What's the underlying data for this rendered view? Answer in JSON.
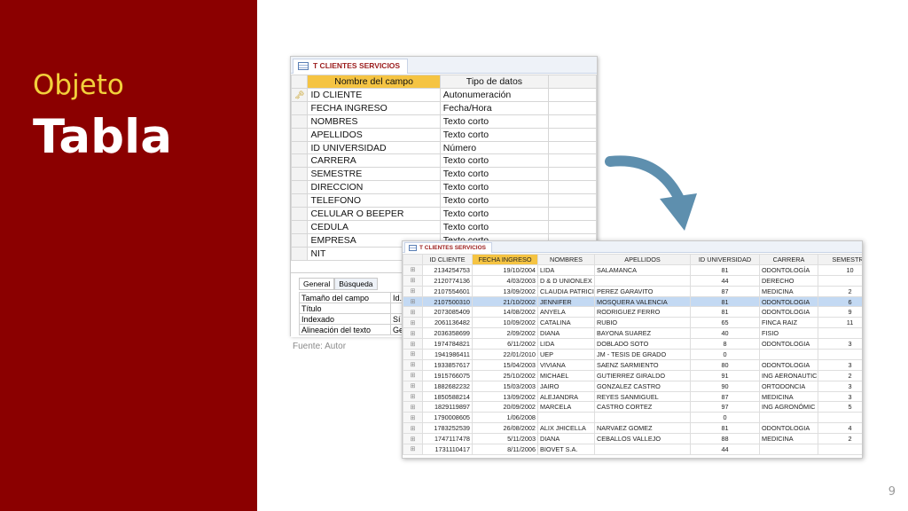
{
  "slide": {
    "subtitle": "Objeto",
    "title": "Tabla",
    "page_number": "9",
    "caption": "Fuente: Autor",
    "colors": {
      "panel": "#8b0000",
      "subtitle": "#f2d03b",
      "title": "#ffffff"
    }
  },
  "design_view": {
    "tab_label": "T CLIENTES SERVICIOS",
    "headers": {
      "name": "Nombre del campo",
      "type": "Tipo de datos"
    },
    "fields": [
      {
        "name": "ID CLIENTE",
        "type": "Autonumeración",
        "key": true
      },
      {
        "name": "FECHA INGRESO",
        "type": "Fecha/Hora",
        "key": false
      },
      {
        "name": "NOMBRES",
        "type": "Texto corto",
        "key": false
      },
      {
        "name": "APELLIDOS",
        "type": "Texto corto",
        "key": false
      },
      {
        "name": "ID UNIVERSIDAD",
        "type": "Número",
        "key": false
      },
      {
        "name": "CARRERA",
        "type": "Texto corto",
        "key": false
      },
      {
        "name": "SEMESTRE",
        "type": "Texto corto",
        "key": false
      },
      {
        "name": "DIRECCION",
        "type": "Texto corto",
        "key": false
      },
      {
        "name": "TELEFONO",
        "type": "Texto corto",
        "key": false
      },
      {
        "name": "CELULAR O BEEPER",
        "type": "Texto corto",
        "key": false
      },
      {
        "name": "CEDULA",
        "type": "Texto corto",
        "key": false
      },
      {
        "name": "EMPRESA",
        "type": "Texto corto",
        "key": false
      },
      {
        "name": "NIT",
        "type": "Texto corto",
        "key": false
      }
    ],
    "property_tabs": [
      "General",
      "Búsqueda"
    ],
    "properties": [
      {
        "label": "Tamaño del campo",
        "value": "Id."
      },
      {
        "label": "Título",
        "value": ""
      },
      {
        "label": "Indexado",
        "value": "Sí ("
      },
      {
        "label": "Alineación del texto",
        "value": "Ge"
      }
    ]
  },
  "datasheet_view": {
    "tab_label": "T CLIENTES SERVICIOS",
    "columns": [
      "ID CLIENTE",
      "FECHA INGRESO",
      "NOMBRES",
      "APELLIDOS",
      "ID UNIVERSIDAD",
      "CARRERA",
      "SEMESTRE"
    ],
    "rows": [
      [
        "2134254753",
        "19/10/2004",
        "LIDA",
        "SALAMANCA",
        "81",
        "ODONTOLOGÍA",
        "10"
      ],
      [
        "2120774136",
        "4/03/2003",
        "D & D UNIONLEX",
        "",
        "44",
        "DERECHO",
        ""
      ],
      [
        "2107554601",
        "13/09/2002",
        "CLAUDIA PATRICI",
        "PEREZ GARAVITO",
        "87",
        "MEDICINA",
        "2"
      ],
      [
        "2107500310",
        "21/10/2002",
        "JENNIFER",
        "MOSQUERA VALENCIA",
        "81",
        "ODONTOLOGIA",
        "6"
      ],
      [
        "2073085409",
        "14/08/2002",
        "ANYELA",
        "RODRIGUEZ FERRO",
        "81",
        "ODONTOLOGIA",
        "9"
      ],
      [
        "2061136482",
        "10/09/2002",
        "CATALINA",
        "RUBIO",
        "65",
        "FINCA RAIZ",
        "11"
      ],
      [
        "2036358699",
        "2/09/2002",
        "DIANA",
        "BAYONA SUAREZ",
        "40",
        "FISIO",
        ""
      ],
      [
        "1974784821",
        "6/11/2002",
        "LIDA",
        "DOBLADO SOTO",
        "8",
        "ODONTOLOGIA",
        "3"
      ],
      [
        "1941986411",
        "22/01/2010",
        "UEP",
        "JM - TESIS DE GRADO",
        "0",
        "",
        ""
      ],
      [
        "1933857617",
        "15/04/2003",
        "VIVIANA",
        "SAENZ SARMIENTO",
        "80",
        "ODONTOLOGIA",
        "3"
      ],
      [
        "1915766075",
        "25/10/2002",
        "MICHAEL",
        "GUTIERREZ GIRALDO",
        "91",
        "ING AERONAUTIC",
        "2"
      ],
      [
        "1882682232",
        "15/03/2003",
        "JAIRO",
        "GONZALEZ CASTRO",
        "90",
        "ORTODONCIA",
        "3"
      ],
      [
        "1850588214",
        "13/09/2002",
        "ALEJANDRA",
        "REYES SANMIGUEL",
        "87",
        "MEDICINA",
        "3"
      ],
      [
        "1829119897",
        "20/09/2002",
        "MARCELA",
        "CASTRO CORTEZ",
        "97",
        "ING AGRONÓMIC",
        "5"
      ],
      [
        "1790008605",
        "1/06/2008",
        "",
        "",
        "0",
        "",
        ""
      ],
      [
        "1783252539",
        "26/08/2002",
        "ALIX JHICELLA",
        "NARVAEZ GOMEZ",
        "81",
        "ODONTOLOGIA",
        "4"
      ],
      [
        "1747117478",
        "5/11/2003",
        "DIANA",
        "CEBALLOS VALLEJO",
        "88",
        "MEDICINA",
        "2"
      ],
      [
        "1731110417",
        "8/11/2006",
        "BIOVET S.A.",
        "",
        "44",
        "",
        ""
      ]
    ],
    "selected_row_index": 3
  }
}
